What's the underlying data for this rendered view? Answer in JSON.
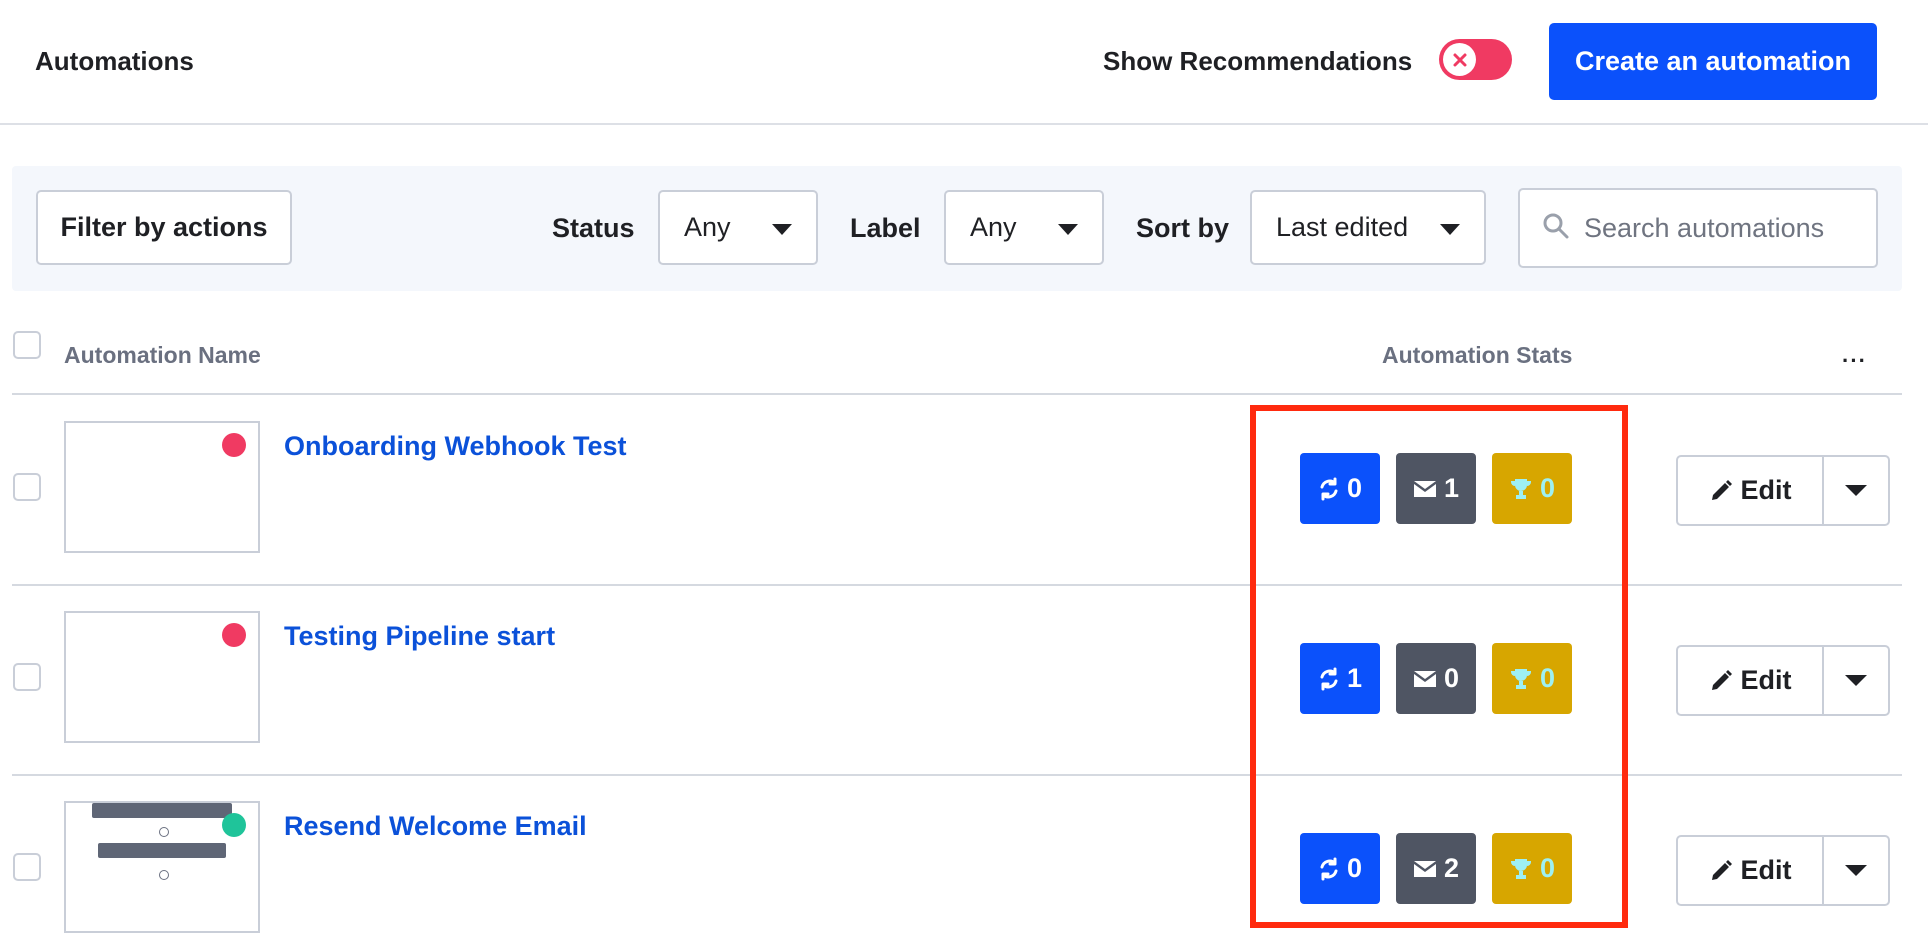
{
  "header": {
    "title": "Automations",
    "recommendations_label": "Show Recommendations",
    "recommendations_enabled": false,
    "create_button": "Create an automation"
  },
  "filters": {
    "filter_by_actions": "Filter by actions",
    "status_label": "Status",
    "status_value": "Any",
    "label_label": "Label",
    "label_value": "Any",
    "sort_label": "Sort by",
    "sort_value": "Last edited",
    "search_placeholder": "Search automations"
  },
  "table": {
    "col_name": "Automation Name",
    "col_stats": "Automation Stats",
    "more": "···",
    "edit_label": "Edit",
    "rows": [
      {
        "name": "Onboarding Webhook Test",
        "status_color": "#f03a62",
        "stats": {
          "contacts": "0",
          "emails": "1",
          "goals": "0"
        }
      },
      {
        "name": "Testing Pipeline start",
        "status_color": "#f03a62",
        "stats": {
          "contacts": "1",
          "emails": "0",
          "goals": "0"
        }
      },
      {
        "name": "Resend Welcome Email",
        "status_color": "#1fc49a",
        "stats": {
          "contacts": "0",
          "emails": "2",
          "goals": "0"
        }
      }
    ]
  },
  "colors": {
    "primary": "#0b51fb",
    "link": "#0b51d9",
    "inactive": "#f03a62",
    "active": "#1fc49a",
    "highlight": "#ff2a0e"
  },
  "icons": [
    "close-icon",
    "search-icon",
    "caret-down-icon",
    "sync-icon",
    "envelope-icon",
    "trophy-icon",
    "pencil-icon",
    "more-icon"
  ]
}
